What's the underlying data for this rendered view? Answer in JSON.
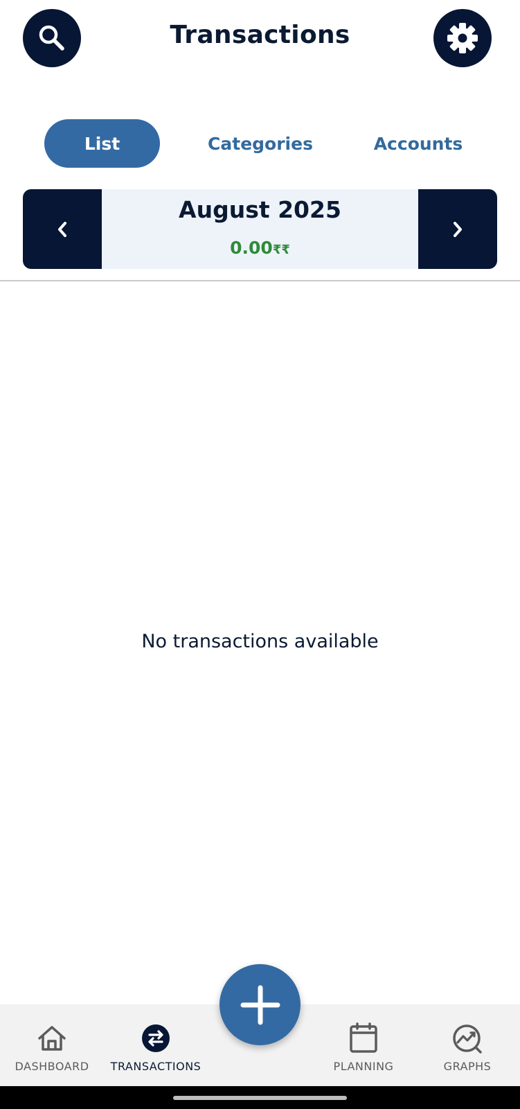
{
  "header": {
    "title": "Transactions",
    "search_icon": "search-icon",
    "settings_icon": "gear-icon"
  },
  "tabs": [
    {
      "label": "List",
      "active": true
    },
    {
      "label": "Categories",
      "active": false
    },
    {
      "label": "Accounts",
      "active": false
    }
  ],
  "period": {
    "month_label": "August 2025",
    "total_value": "0.00",
    "currency": "₹₹",
    "total_color": "#2e8b3a",
    "prev_icon": "chevron-left-icon",
    "next_icon": "chevron-right-icon"
  },
  "empty_state": {
    "message": "No transactions available"
  },
  "fab": {
    "icon": "plus-icon"
  },
  "bottom_nav": {
    "items": [
      {
        "label": "DASHBOARD",
        "icon": "home-icon",
        "active": false
      },
      {
        "label": "TRANSACTIONS",
        "icon": "swap-arrows-icon",
        "active": true
      },
      {
        "label": "PLANNING",
        "icon": "calendar-icon",
        "active": false
      },
      {
        "label": "GRAPHS",
        "icon": "chart-trend-icon",
        "active": false
      }
    ]
  },
  "colors": {
    "primary_dark": "#061634",
    "accent_blue": "#346aa3",
    "positive_green": "#2e8b3a"
  }
}
